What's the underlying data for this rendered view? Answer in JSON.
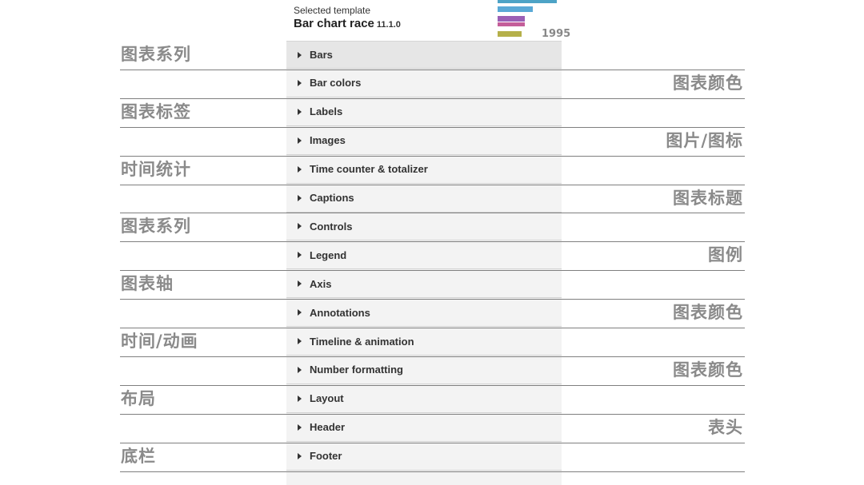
{
  "template": {
    "caption": "Selected template",
    "title": "Bar chart race",
    "version": "11.1.0",
    "thumbnail_year": "1995"
  },
  "sections": [
    {
      "label": "Bars"
    },
    {
      "label": "Bar colors"
    },
    {
      "label": "Labels"
    },
    {
      "label": "Images"
    },
    {
      "label": "Time counter & totalizer"
    },
    {
      "label": "Captions"
    },
    {
      "label": "Controls"
    },
    {
      "label": "Legend"
    },
    {
      "label": "Axis"
    },
    {
      "label": "Annotations"
    },
    {
      "label": "Timeline & animation"
    },
    {
      "label": "Number formatting"
    },
    {
      "label": "Layout"
    },
    {
      "label": "Header"
    },
    {
      "label": "Footer"
    }
  ],
  "annotations": [
    {
      "text": "图表系列",
      "side": "left"
    },
    {
      "text": "图表颜色",
      "side": "right"
    },
    {
      "text": "图表标签",
      "side": "left"
    },
    {
      "text": "图片/图标",
      "side": "right"
    },
    {
      "text": "时间统计",
      "side": "left"
    },
    {
      "text": "图表标题",
      "side": "right"
    },
    {
      "text": "图表系列",
      "side": "left"
    },
    {
      "text": "图例",
      "side": "right"
    },
    {
      "text": "图表轴",
      "side": "left"
    },
    {
      "text": "图表颜色",
      "side": "right"
    },
    {
      "text": "时间/动画",
      "side": "left"
    },
    {
      "text": "图表颜色",
      "side": "right"
    },
    {
      "text": "布局",
      "side": "left"
    },
    {
      "text": "表头",
      "side": "right"
    },
    {
      "text": "底栏",
      "side": "left"
    }
  ],
  "colors": {
    "panel_bg": "#f3f3f3",
    "active_bg": "#e6e6e6",
    "annotation_text": "#8a8a8a"
  }
}
